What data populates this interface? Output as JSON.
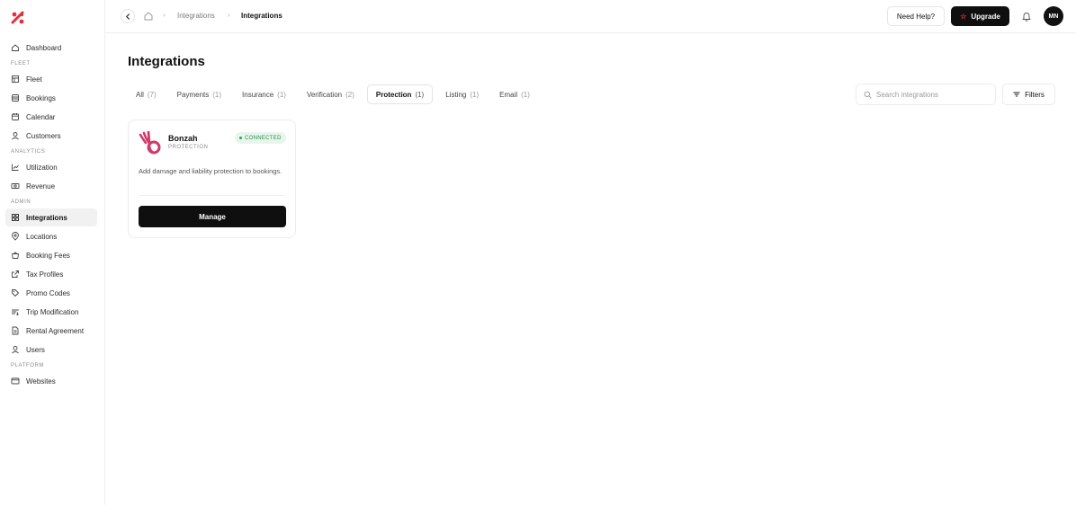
{
  "sidebar": {
    "items": [
      {
        "label": "Dashboard",
        "icon": "home-icon"
      },
      {
        "section": "FLEET"
      },
      {
        "label": "Fleet",
        "icon": "layout-icon"
      },
      {
        "label": "Bookings",
        "icon": "bookings-icon"
      },
      {
        "label": "Calendar",
        "icon": "calendar-icon"
      },
      {
        "label": "Customers",
        "icon": "user-icon"
      },
      {
        "section": "ANALYTICS"
      },
      {
        "label": "Utilization",
        "icon": "chart-line-icon"
      },
      {
        "label": "Revenue",
        "icon": "cash-icon"
      },
      {
        "section": "ADMIN"
      },
      {
        "label": "Integrations",
        "icon": "grid-icon",
        "active": true
      },
      {
        "label": "Locations",
        "icon": "map-pin-icon"
      },
      {
        "label": "Booking Fees",
        "icon": "bag-icon"
      },
      {
        "label": "Tax Profiles",
        "icon": "external-icon"
      },
      {
        "label": "Promo Codes",
        "icon": "tag-icon"
      },
      {
        "label": "Trip Modification",
        "icon": "sliders-icon"
      },
      {
        "label": "Rental Agreement",
        "icon": "document-icon"
      },
      {
        "label": "Users",
        "icon": "user-icon"
      },
      {
        "section": "PLATFORM"
      },
      {
        "label": "Websites",
        "icon": "browser-icon"
      }
    ]
  },
  "topbar": {
    "breadcrumb": [
      "Integrations",
      "Integrations"
    ],
    "help_label": "Need Help?",
    "upgrade_label": "Upgrade",
    "avatar_initials": "MN"
  },
  "main": {
    "title": "Integrations",
    "tabs": [
      {
        "label": "All",
        "count": "(7)"
      },
      {
        "label": "Payments",
        "count": "(1)"
      },
      {
        "label": "Insurance",
        "count": "(1)"
      },
      {
        "label": "Verification",
        "count": "(2)"
      },
      {
        "label": "Protection",
        "count": "(1)",
        "active": true
      },
      {
        "label": "Listing",
        "count": "(1)"
      },
      {
        "label": "Email",
        "count": "(1)"
      }
    ],
    "search_placeholder": "Search integrations",
    "filters_label": "Filters",
    "cards": [
      {
        "name": "Bonzah",
        "category": "PROTECTION",
        "status": "CONNECTED",
        "description": "Add damage and liability protection to bookings.",
        "action_label": "Manage"
      }
    ]
  },
  "colors": {
    "brand": "#e0303a",
    "primary_button": "#0f0f0f",
    "status_connected_bg": "#e7f6ec",
    "status_connected_text": "#2f8a4c",
    "bonzah_logo": "#d13a6a"
  }
}
